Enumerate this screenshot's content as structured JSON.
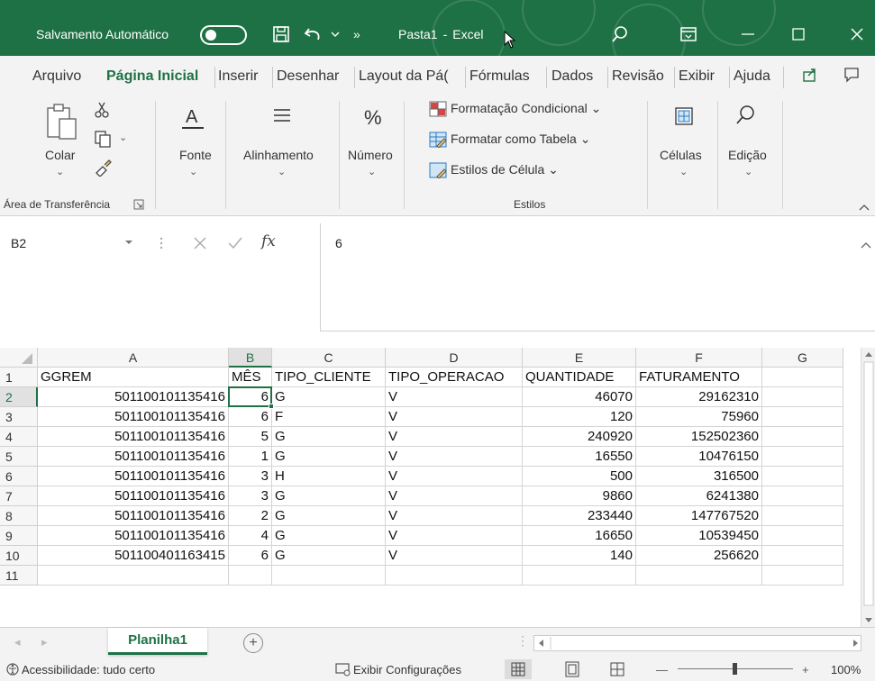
{
  "titlebar": {
    "autosave_label": "Salvamento Automático",
    "more": "»",
    "file_name": "Pasta1",
    "separator": "-",
    "app_name": "Excel",
    "bg_color": "#1e7145"
  },
  "tabs": [
    "Arquivo",
    "Página Inicial",
    "Inserir",
    "Desenhar",
    "Layout da Pá(",
    "Fórmulas",
    "Dados",
    "Revisão",
    "Exibir",
    "Ajuda"
  ],
  "ribbon": {
    "paste": "Colar",
    "clipboard_group": "Área de Transferência",
    "font": "Fonte",
    "alignment": "Alinhamento",
    "number": "Número",
    "cond_format": "Formatação Condicional",
    "format_table": "Formatar como Tabela",
    "cell_styles": "Estilos de Célula",
    "styles_group": "Estilos",
    "cells": "Células",
    "editing": "Edição"
  },
  "formula_bar": {
    "name_box": "B2",
    "fx": "fx",
    "value": "6"
  },
  "grid": {
    "columns": [
      "A",
      "B",
      "C",
      "D",
      "E",
      "F",
      "G"
    ],
    "selected_column": "B",
    "row_numbers": [
      "1",
      "2",
      "3",
      "5",
      "4",
      "5",
      "6",
      "7",
      "8",
      "9",
      "10",
      "11"
    ],
    "header": [
      "GGREM",
      "MÊS",
      "TIPO_CLIENTE",
      "TIPO_OPERACAO",
      "QUANTIDADE",
      "FATURAMENTO"
    ],
    "rows": [
      [
        "501100101135416",
        "6",
        "G",
        "V",
        "46070",
        "29162310"
      ],
      [
        "501100101135416",
        "6",
        "F",
        "V",
        "120",
        "75960"
      ],
      [
        "501100101135416",
        "5",
        "G",
        "V",
        "240920",
        "152502360"
      ],
      [
        "501100101135416",
        "1",
        "G",
        "V",
        "16550",
        "10476150"
      ],
      [
        "501100101135416",
        "3",
        "H",
        "V",
        "500",
        "316500"
      ],
      [
        "501100101135416",
        "3",
        "G",
        "V",
        "9860",
        "6241380"
      ],
      [
        "501100101135416",
        "2",
        "G",
        "V",
        "233440",
        "147767520"
      ],
      [
        "501100101135416",
        "4",
        "G",
        "V",
        "16650",
        "10539450"
      ],
      [
        "501100401163415",
        "6",
        "G",
        "V",
        "140",
        "256620"
      ]
    ]
  },
  "sheet": {
    "active_tab": "Planilha1",
    "add": "+"
  },
  "status": {
    "accessibility": "Acessibilidade: tudo certo",
    "display_settings": "Exibir Configurações",
    "zoom_plus": "+",
    "zoom_minus": "—",
    "zoom": "100%"
  }
}
